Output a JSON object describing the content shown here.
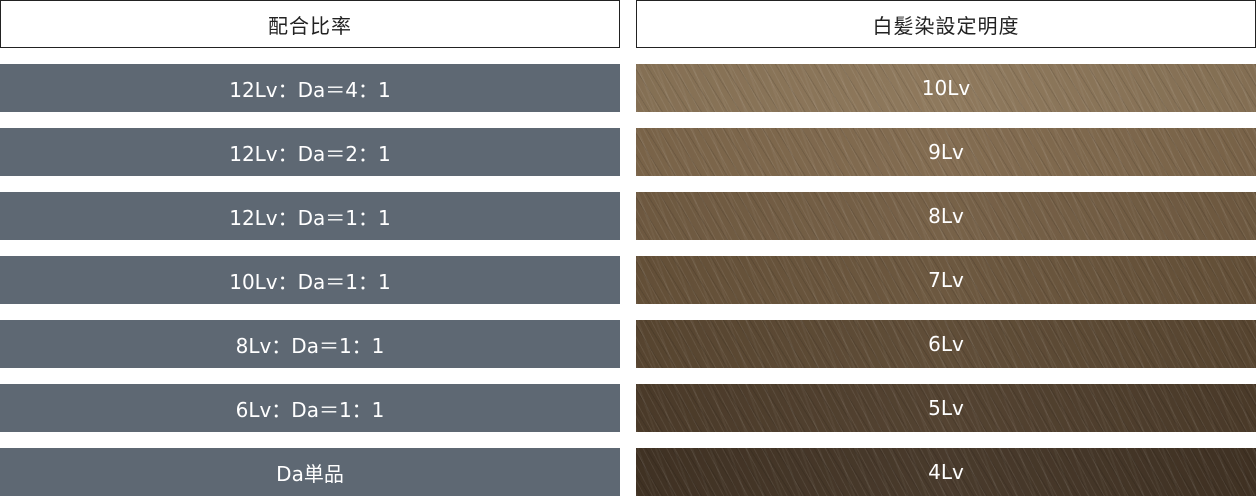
{
  "left_column": {
    "header": "配合比率",
    "rows": [
      "12Lv：Da＝4：1",
      "12Lv：Da＝2：1",
      "12Lv：Da＝1：1",
      "10Lv：Da＝1：1",
      "8Lv：Da＝1：1",
      "6Lv：Da＝1：1",
      "Da単品"
    ]
  },
  "right_column": {
    "header": "白髪染設定明度",
    "rows": [
      {
        "label": "10Lv",
        "color": "#8b7558"
      },
      {
        "label": "9Lv",
        "color": "#7f684c"
      },
      {
        "label": "8Lv",
        "color": "#735d43"
      },
      {
        "label": "7Lv",
        "color": "#68533a"
      },
      {
        "label": "6Lv",
        "color": "#5b4832"
      },
      {
        "label": "5Lv",
        "color": "#4e3d2b"
      },
      {
        "label": "4Lv",
        "color": "#433425"
      }
    ]
  },
  "colors": {
    "ratio_row_bg": "#5e6873",
    "header_border": "#222222",
    "row_text": "#ffffff"
  }
}
